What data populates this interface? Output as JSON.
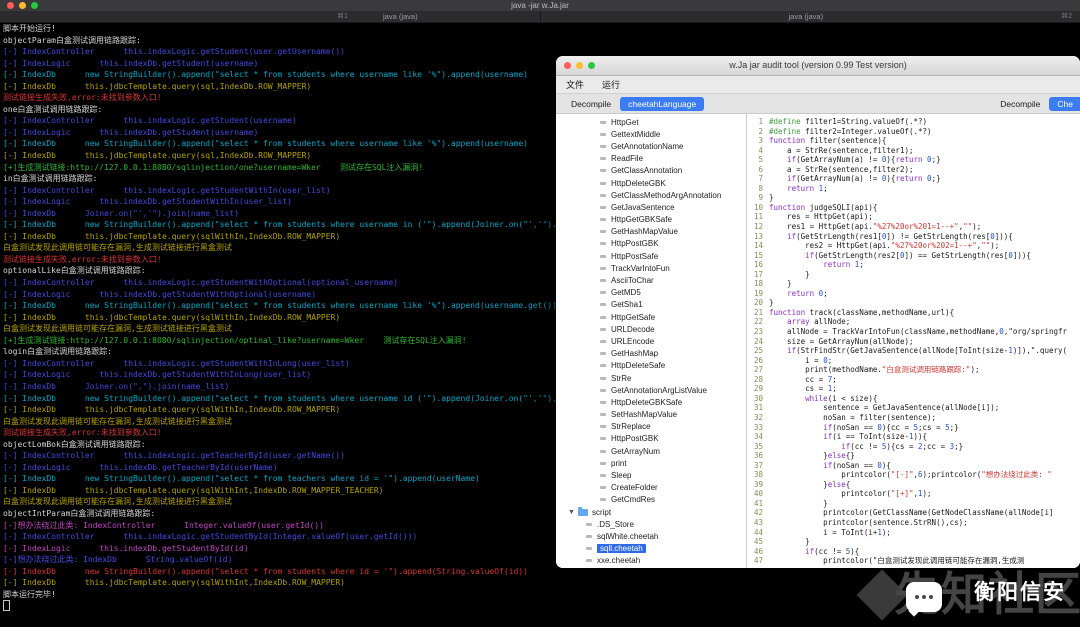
{
  "terminal": {
    "title": "java -jar w.Ja.jar",
    "tabs": [
      {
        "hint": "⌘1",
        "label": "java (java)"
      },
      {
        "hint": "⌘2",
        "label": "java (java)"
      }
    ],
    "lines": [
      {
        "c": "w",
        "t": "脚本开始运行!"
      },
      {
        "c": "w",
        "t": "objectParam白盒测试调用链路跟踪:"
      },
      {
        "c": "b",
        "t": "[-] IndexController      this.indexLogic.getStudent(user.getUsername())"
      },
      {
        "c": "b",
        "t": "[-] IndexLogic      this.indexDb.getStudent(username)"
      },
      {
        "c": "c",
        "t": "[-] IndexDb      new StringBuilder().append(\"select * from students where username like '%\").append(username)"
      },
      {
        "c": "y",
        "t": "[-] IndexDb      this.jdbcTemplate.query(sql,IndexDb.ROW_MAPPER)"
      },
      {
        "c": "r",
        "t": "测试链接生成失败,error:未找到参数入口!"
      },
      {
        "c": "w",
        "t": "one白盒测试调用链路跟踪:"
      },
      {
        "c": "b",
        "t": "[-] IndexController      this.indexLogic.getStudent(username)"
      },
      {
        "c": "b",
        "t": "[-] IndexLogic      this.indexDb.getStudent(username)"
      },
      {
        "c": "c",
        "t": "[-] IndexDb      new StringBuilder().append(\"select * from students where username like '%\").append(username)"
      },
      {
        "c": "y",
        "t": "[-] IndexDb      this.jdbcTemplate.query(sql,IndexDb.ROW_MAPPER)"
      },
      {
        "c": "g",
        "t": "[+]生成测试链接:http://127.0.0.1:8080/sqlinjection/one?username=Wker    测试存在SQL注入漏洞!"
      },
      {
        "c": "w",
        "t": "in白盒测试调用链路跟踪:"
      },
      {
        "c": "b",
        "t": "[-] IndexController      this.indexLogic.getStudentWithIn(user_list)"
      },
      {
        "c": "b",
        "t": "[-] IndexLogic      this.indexDb.getStudentWithIn(user_list)"
      },
      {
        "c": "b",
        "t": "[-] IndexDb      Joiner.on(\"','\").join(name_list)"
      },
      {
        "c": "c",
        "t": "[-] IndexDb      new StringBuilder().append(\"select * from students where username in ('\").append(Joiner.on(\"','\").join(name_l"
      },
      {
        "c": "y",
        "t": "[-] IndexDb      this.jdbcTemplate.query(sqlWithIn,IndexDb.ROW_MAPPER)"
      },
      {
        "c": "y",
        "t": "白盒测试发现此调用链可能存在漏洞,生成测试链接进行黑盒测试"
      },
      {
        "c": "r",
        "t": "测试链接生成失败,error:未找到参数入口!"
      },
      {
        "c": "w",
        "t": "optionalLike白盒测试调用链路跟踪:"
      },
      {
        "c": "b",
        "t": "[-] IndexController      this.indexLogic.getStudentWithOptional(optional_username)"
      },
      {
        "c": "b",
        "t": "[-] IndexLogic      this.indexDb.getStudentWithOptional(username)"
      },
      {
        "c": "c",
        "t": "[-] IndexDb      new StringBuilder().append(\"select * from students where username like '%\").append(username.get())"
      },
      {
        "c": "y",
        "t": "[-] IndexDb      this.jdbcTemplate.query(sqlWithIn,IndexDb.ROW_MAPPER)"
      },
      {
        "c": "y",
        "t": "白盒测试发现此调用链可能存在漏洞,生成测试链接进行黑盒测试"
      },
      {
        "c": "g",
        "t": "[+]生成测试链接:http://127.0.0.1:8080/sqlinjection/optinal_like?username=Wker    测试存在SQL注入漏洞!"
      },
      {
        "c": "w",
        "t": "login白盒测试调用链路跟踪:"
      },
      {
        "c": "b",
        "t": "[-] IndexController      this.indexLogic.getStudentWithInLong(user_list)"
      },
      {
        "c": "b",
        "t": "[-] IndexLogic      this.indexDb.getStudentWithInLong(user_list)"
      },
      {
        "c": "b",
        "t": "[-] IndexDb      Joiner.on(\",\").join(name_list)"
      },
      {
        "c": "c",
        "t": "[-] IndexDb      new StringBuilder().append(\"select * from students where username id ('\").append(Joiner.on(\"','\").join(name_l"
      },
      {
        "c": "y",
        "t": "[-] IndexDb      this.jdbcTemplate.query(sqlWithIn,IndexDb.ROW_MAPPER)"
      },
      {
        "c": "y",
        "t": "白盒测试发现此调用链可能存在漏洞,生成测试链接进行黑盒测试"
      },
      {
        "c": "r",
        "t": "测试链接生成失败,error:未找到参数入口!"
      },
      {
        "c": "w",
        "t": "objectLomBok白盒测试调用链路跟踪:"
      },
      {
        "c": "b",
        "t": "[-] IndexController      this.indexLogic.getTeacherById(user.getName())"
      },
      {
        "c": "b",
        "t": "[-] IndexLogic      this.indexDb.getTeacherById(userName)"
      },
      {
        "c": "c",
        "t": "[-] IndexDb      new StringBuilder().append(\"select * from teachers where id = '\").append(userName)"
      },
      {
        "c": "y",
        "t": "[-] IndexDb      this.jdbcTemplate.query(sqlWithInt,IndexDb.ROW_MAPPER_TEACHER)"
      },
      {
        "c": "y",
        "t": "白盒测试发现此调用链可能存在漏洞,生成测试链接进行黑盒测试"
      },
      {
        "c": "w",
        "t": "objectIntParam白盒测试调用链路跟踪:"
      },
      {
        "c": "m",
        "t": "[-]想办法绕过此类: IndexController      Integer.valueOf(user.getId())"
      },
      {
        "c": "b",
        "t": "[-] IndexController      this.indexLogic.getStudentById(Integer.valueOf(user.getId()))"
      },
      {
        "c": "m",
        "t": "[-] IndexLogic      this.indexDb.getStudentById(id)"
      },
      {
        "c": "b",
        "t": "[-]想办法绕过此类: IndexDb      String.valueOf(id)"
      },
      {
        "c": "r",
        "t": "[-] IndexDb      new StringBuilder().append(\"select * from students where id = '\").append(String.valueOf(id))"
      },
      {
        "c": "y",
        "t": "[-] IndexDb      this.jdbcTemplate.query(sqlWithInt,IndexDb.ROW_MAPPER)"
      },
      {
        "c": "w",
        "t": "脚本运行完毕!"
      },
      {
        "c": "cursor",
        "t": ""
      }
    ]
  },
  "audit": {
    "title": "w.Ja jar audit tool (version 0.99 Test version)",
    "menu": [
      "文件",
      "运行"
    ],
    "left_tabs": [
      {
        "label": "Decompile",
        "active": false
      },
      {
        "label": "cheetahLanguage",
        "active": true
      }
    ],
    "right_tabs": [
      {
        "label": "Decompile",
        "active": false
      },
      {
        "label": "Che",
        "active": true
      }
    ],
    "tree": {
      "functions": [
        "HttpGet",
        "GettextMiddle",
        "GetAnnotationName",
        "ReadFile",
        "GetClassAnnotation",
        "HttpDeleteGBK",
        "GetClassMethodArgAnnotation",
        "GetJavaSentence",
        "HttpGetGBKSafe",
        "GetHashMapValue",
        "HttpPostGBK",
        "HttpPostSafe",
        "TrackVarIntoFun",
        "AsciiToChar",
        "GetMD5",
        "GetSha1",
        "HttpGetSafe",
        "URLDecode",
        "URLEncode",
        "GetHashMap",
        "HttpDeleteSafe",
        "StrRe",
        "GetAnnotationArgListValue",
        "HttpDeleteGBKSafe",
        "SetHashMapValue",
        "StrReplace",
        "HttpPostGBK",
        "GetArrayNum",
        "print",
        "Sleep",
        "CreateFolder",
        "GetCmdRes"
      ],
      "script_folder": "script",
      "script_children": [
        {
          "label": ".DS_Store",
          "selected": false
        },
        {
          "label": "sqlWhite.cheetah",
          "selected": false
        },
        {
          "label": "sqll.cheetah",
          "selected": true
        },
        {
          "label": "xxe.cheetah",
          "selected": false
        }
      ]
    },
    "code_lines": [
      "#define filter1=String.valueOf(.*?)",
      "#define filter2=Integer.valueOf(.*?)",
      "function filter(sentence){",
      "    a = StrRe(sentence,filter1);",
      "    if(GetArrayNum(a) != 0){return 0;}",
      "    a = StrRe(sentence,filter2);",
      "    if(GetArrayNum(a) != 0){return 0;}",
      "    return 1;",
      "}",
      "function judgeSQLI(api){",
      "    res = HttpGet(api);",
      "    res1 = HttpGet(api.\"%27%20or%201=1--+\",\"\");",
      "    if(GetStrLength(res1[0]) != GetStrLength(res[0])){",
      "        res2 = HttpGet(api.\"%27%20or%202=1--+\",\"\");",
      "        if(GetStrLength(res2[0]) == GetStrLength(res[0])){",
      "            return 1;",
      "        }",
      "    }",
      "    return 0;",
      "}",
      "function track(className,methodName,url){",
      "    array allNode;",
      "    allNode = TrackVarIntoFun(className,methodName,0,\"org/springfr",
      "    size = GetArrayNum(allNode);",
      "    if(StrFindStr(GetJavaSentence(allNode[ToInt(size-1)]),\".query(",
      "        i = 0;",
      "        print(methodName.\"白盒测试调用链路跟踪:\");",
      "        cc = 7;",
      "        cs = 1;",
      "        while(i < size){",
      "            sentence = GetJavaSentence(allNode[i]);",
      "            noSan = filter(sentence);",
      "            if(noSan == 0){cc = 5;cs = 5;}",
      "            if(i == ToInt(size-1)){",
      "                if(cc != 5){cs = 2;cc = 3;}",
      "            }else{}",
      "            if(noSan == 0){",
      "                printcolor(\"[-]\",6);printcolor(\"想办法绕过此类: \"",
      "            }else{",
      "                printcolor(\"[+]\",1);",
      "            }",
      "            printcolor(GetClassName(GetNodeClassName(allNode[i]",
      "            printcolor(sentence.StrRN(),cs);",
      "            i = ToInt(i+1);",
      "        }",
      "        if(cc != 5){",
      "            printcolor(\"白盒测试发现此调用链可能存在漏洞,生成测"
    ]
  },
  "watermark": {
    "big": "先知社区",
    "brand": "衡阳信安"
  },
  "colors": {
    "accent_blue": "#3b7cf5",
    "selection_blue": "#2f6be4",
    "term_blue": "#4449e0",
    "term_cyan": "#00a8c8",
    "term_yellow": "#b5a300",
    "term_red": "#dd3333",
    "term_green": "#2eb82e",
    "term_magenta": "#c243c2"
  }
}
